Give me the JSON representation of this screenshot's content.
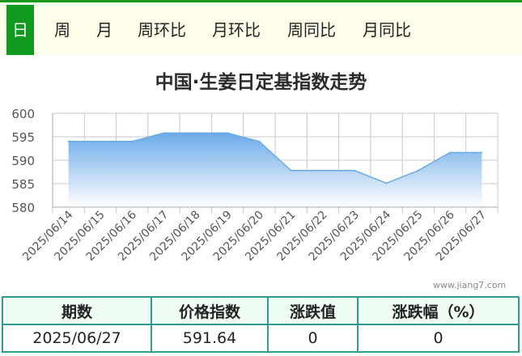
{
  "tabs": [
    {
      "label": "日",
      "active": true
    },
    {
      "label": "周"
    },
    {
      "label": "月"
    },
    {
      "label": "周环比"
    },
    {
      "label": "月环比"
    },
    {
      "label": "周同比"
    },
    {
      "label": "月同比"
    }
  ],
  "watermark": "www.jiang7.com",
  "chart_data": {
    "type": "area",
    "title": "中国·生姜日定基指数走势",
    "x": [
      "2025/06/14",
      "2025/06/15",
      "2025/06/16",
      "2025/06/17",
      "2025/06/18",
      "2025/06/19",
      "2025/06/20",
      "2025/06/21",
      "2025/06/22",
      "2025/06/23",
      "2025/06/24",
      "2025/06/25",
      "2025/06/26",
      "2025/06/27"
    ],
    "values": [
      594,
      594,
      594,
      595.8,
      595.8,
      595.8,
      594,
      587.8,
      587.8,
      587.8,
      585.1,
      587.8,
      591.64,
      591.64
    ],
    "ylim": [
      580,
      600
    ],
    "yticks": [
      580,
      585,
      590,
      595,
      600
    ],
    "grid": true,
    "colors": {
      "fill_top": "#6aaae8",
      "fill_bottom": "#ffffff",
      "line": "#6aaae8",
      "grid": "#c8c8c8"
    }
  },
  "summary": {
    "headers": [
      "期数",
      "价格指数",
      "涨跌值",
      "涨跌幅（%）"
    ],
    "row": [
      "2025/06/27",
      "591.64",
      "0",
      "0"
    ]
  }
}
